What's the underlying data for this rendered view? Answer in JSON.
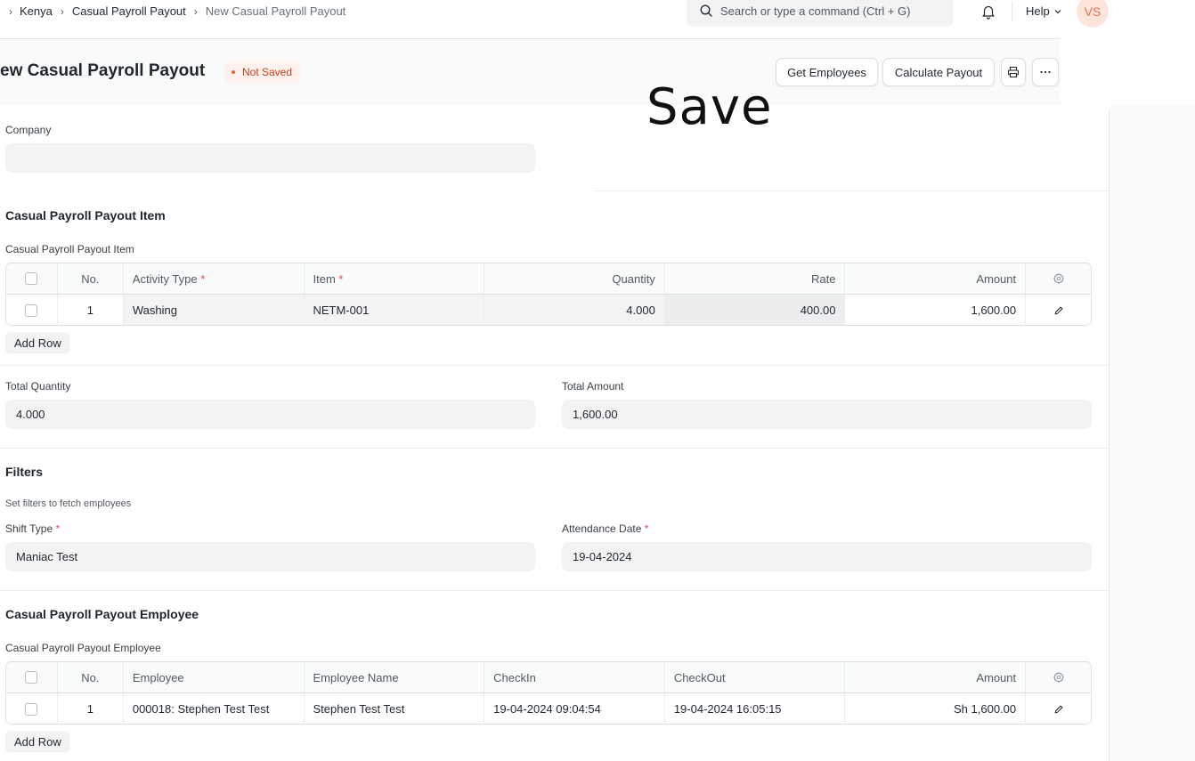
{
  "navbar": {
    "breadcrumbs": [
      "Kenya",
      "Casual Payroll Payout",
      "New Casual Payroll Payout"
    ],
    "search_placeholder": "Search or type a command (Ctrl + G)",
    "help_label": "Help",
    "avatar_initials": "VS"
  },
  "page": {
    "title": "ew Casual Payroll Payout",
    "status": "Not Saved",
    "buttons": {
      "get_employees": "Get Employees",
      "calculate_payout": "Calculate Payout"
    },
    "overlay_text": "Save"
  },
  "form": {
    "company_label": "Company",
    "company_value": "",
    "payout_item_section": "Casual Payroll Payout Item",
    "payout_item_table_label": "Casual Payroll Payout Item",
    "items_table": {
      "headers": {
        "no": "No.",
        "activity_type": "Activity Type",
        "item": "Item",
        "quantity": "Quantity",
        "rate": "Rate",
        "amount": "Amount"
      },
      "rows": [
        {
          "no": "1",
          "activity_type": "Washing",
          "item": "NETM-001",
          "quantity": "4.000",
          "rate": "400.00",
          "amount": "1,600.00"
        }
      ],
      "add_row": "Add Row"
    },
    "total_quantity_label": "Total Quantity",
    "total_quantity_value": "4.000",
    "total_amount_label": "Total Amount",
    "total_amount_value": "1,600.00",
    "filters_section": "Filters",
    "filters_desc": "Set filters to fetch employees",
    "shift_type_label": "Shift Type",
    "shift_type_value": "Maniac Test",
    "attendance_date_label": "Attendance Date",
    "attendance_date_value": "19-04-2024",
    "employee_section": "Casual Payroll Payout Employee",
    "employee_table_label": "Casual Payroll Payout Employee",
    "employees_table": {
      "headers": {
        "no": "No.",
        "employee": "Employee",
        "employee_name": "Employee Name",
        "checkin": "CheckIn",
        "checkout": "CheckOut",
        "amount": "Amount"
      },
      "rows": [
        {
          "no": "1",
          "employee": "000018: Stephen Test Test",
          "employee_name": "Stephen Test Test",
          "checkin": "19-04-2024 09:04:54",
          "checkout": "19-04-2024 16:05:15",
          "amount": "Sh 1,600.00"
        }
      ],
      "add_row": "Add Row"
    }
  },
  "colors": {
    "required": "#e24c4c",
    "status_text": "#c0411c",
    "status_bg": "#fff1ed",
    "avatar_bg": "#fde5dc",
    "avatar_text": "#e86c4f"
  }
}
